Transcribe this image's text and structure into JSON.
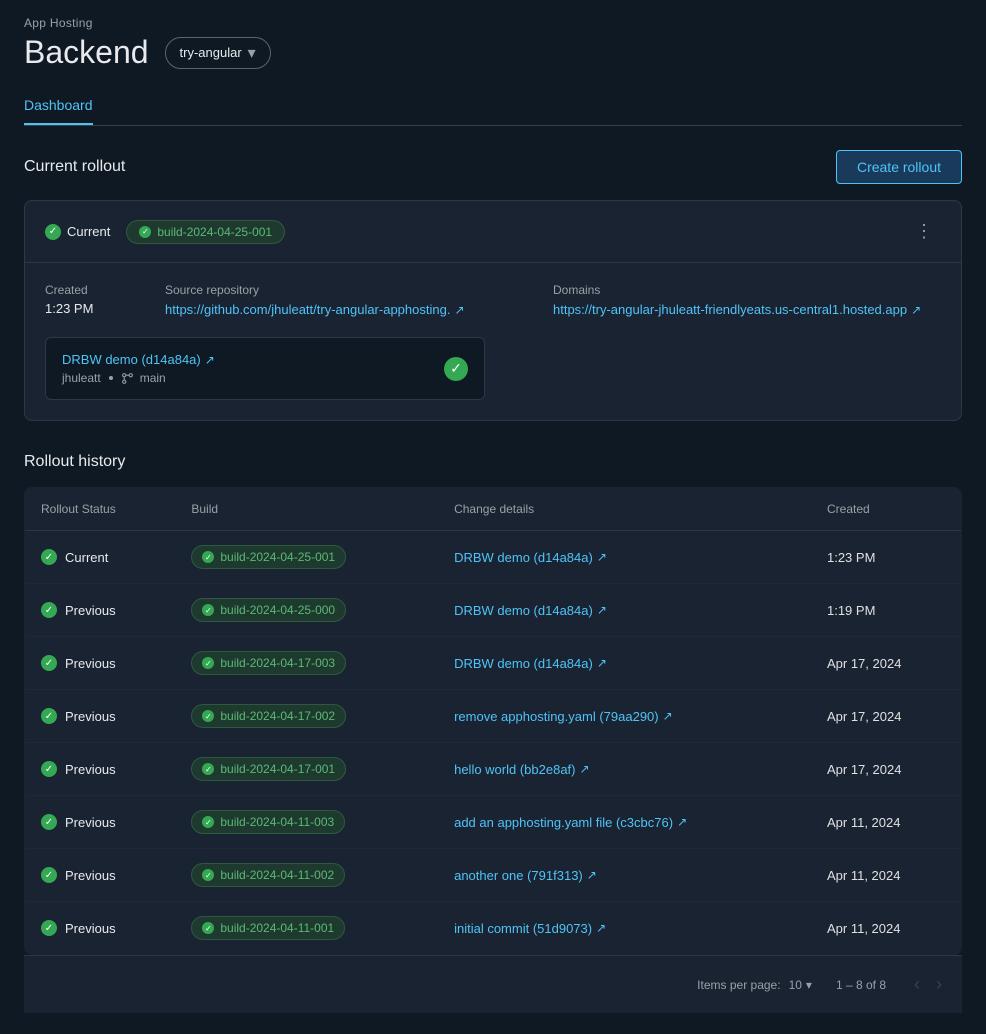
{
  "page": {
    "app_hosting_label": "App Hosting",
    "backend_title": "Backend",
    "branch_selector": "try-angular",
    "tab_dashboard": "Dashboard"
  },
  "current_rollout_section": {
    "title": "Current rollout",
    "create_btn_label": "Create rollout",
    "status_label": "Current",
    "build_id": "build-2024-04-25-001",
    "created_label": "Created",
    "created_value": "1:23 PM",
    "source_repo_label": "Source repository",
    "source_repo_url": "https://github.com/jhuleatt/try-angular-apphosting.",
    "domains_label": "Domains",
    "domain_url": "https://try-angular-jhuleatt-friendlyeats.us-central1.hosted.app",
    "commit_title": "DRBW demo (d14a84a)",
    "commit_author": "jhuleatt",
    "commit_branch": "main",
    "more_options_label": "more options"
  },
  "rollout_history": {
    "title": "Rollout history",
    "columns": {
      "rollout_status": "Rollout Status",
      "build": "Build",
      "change_details": "Change details",
      "created": "Created"
    },
    "rows": [
      {
        "status": "Current",
        "build": "build-2024-04-25-001",
        "change": "DRBW demo (d14a84a)",
        "created": "1:23 PM"
      },
      {
        "status": "Previous",
        "build": "build-2024-04-25-000",
        "change": "DRBW demo (d14a84a)",
        "created": "1:19 PM"
      },
      {
        "status": "Previous",
        "build": "build-2024-04-17-003",
        "change": "DRBW demo (d14a84a)",
        "created": "Apr 17, 2024"
      },
      {
        "status": "Previous",
        "build": "build-2024-04-17-002",
        "change": "remove apphosting.yaml (79aa290)",
        "created": "Apr 17, 2024"
      },
      {
        "status": "Previous",
        "build": "build-2024-04-17-001",
        "change": "hello world (bb2e8af)",
        "created": "Apr 17, 2024"
      },
      {
        "status": "Previous",
        "build": "build-2024-04-11-003",
        "change": "add an apphosting.yaml file (c3cbc76)",
        "created": "Apr 11, 2024"
      },
      {
        "status": "Previous",
        "build": "build-2024-04-11-002",
        "change": "another one (791f313)",
        "created": "Apr 11, 2024"
      },
      {
        "status": "Previous",
        "build": "build-2024-04-11-001",
        "change": "initial commit (51d9073)",
        "created": "Apr 11, 2024"
      }
    ],
    "pagination": {
      "items_per_page_label": "Items per page:",
      "items_per_page_value": "10",
      "range": "1 – 8 of 8"
    }
  }
}
